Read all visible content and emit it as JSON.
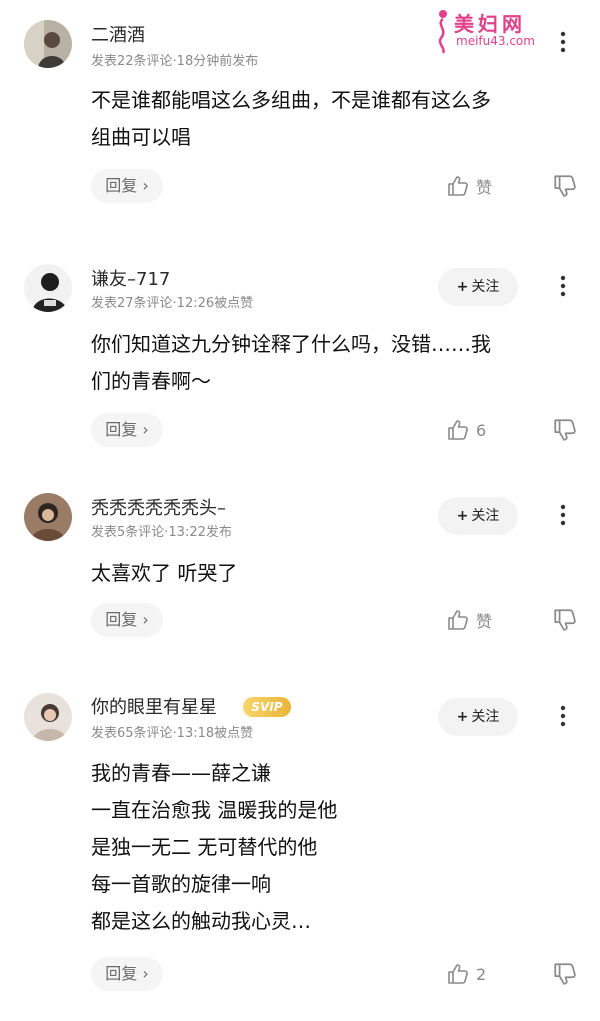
{
  "watermark": {
    "site_name": "美妇网",
    "url": "meifu43.com"
  },
  "comments": [
    {
      "username": "二酒酒",
      "meta": "发表22条评论·18分钟前发布",
      "content_lines": [
        "不是谁都能唱这么多组曲，不是谁都有这么多",
        "组曲可以唱"
      ],
      "reply_label": "回复 ›",
      "like_label": "赞",
      "has_follow": false
    },
    {
      "username": "谦友–717",
      "meta": "发表27条评论·12:26被点赞",
      "content_lines": [
        "你们知道这九分钟诠释了什么吗，没错……我",
        "们的青春啊～"
      ],
      "reply_label": "回复 ›",
      "like_label": "6",
      "follow_label": "关注",
      "has_follow": true
    },
    {
      "username": "秃秃秃秃秃秃头–",
      "meta": "发表5条评论·13:22发布",
      "content_lines": [
        "太喜欢了 听哭了"
      ],
      "reply_label": "回复 ›",
      "like_label": "赞",
      "follow_label": "关注",
      "has_follow": true
    },
    {
      "username": "你的眼里有星星",
      "badge": "SVIP",
      "meta": "发表65条评论·13:18被点赞",
      "content_lines": [
        "我的青春——薛之谦",
        "一直在治愈我 温暖我的是他",
        "是独一无二 无可替代的他",
        "每一首歌的旋律一响",
        "都是这么的触动我心灵…"
      ],
      "reply_label": "回复 ›",
      "like_label": "2",
      "follow_label": "关注",
      "has_follow": true
    }
  ],
  "colors": {
    "accent_watermark": "#e0418a",
    "svip_gold": "#eab43a",
    "muted_text": "#8a8a8a"
  },
  "icons": [
    "more-vertical-icon",
    "thumbs-up-icon",
    "thumbs-down-icon",
    "plus-icon"
  ]
}
